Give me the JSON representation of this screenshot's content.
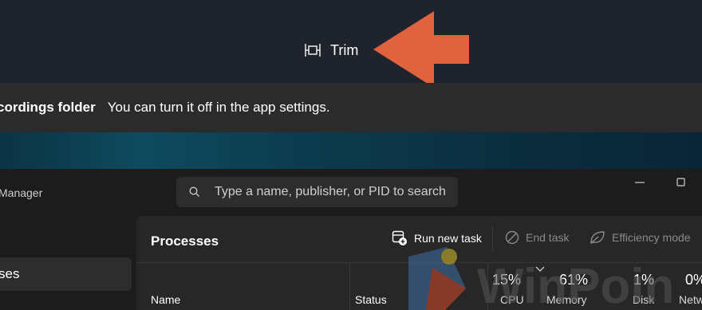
{
  "toolbar": {
    "trim_label": "Trim",
    "trim_icon": "trim-icon",
    "arrow_color": "#e0623f"
  },
  "notification": {
    "title": "cordings folder",
    "text": "You can turn it off in the app settings."
  },
  "task_manager": {
    "title": "Manager",
    "search": {
      "placeholder": "Type a name, publisher, or PID to search"
    },
    "sidebar": {
      "selected_item": "ses"
    },
    "processes": {
      "title": "Processes",
      "commands": {
        "run_new_task": "Run new task",
        "end_task": "End task",
        "efficiency_mode": "Efficiency mode"
      },
      "columns": {
        "name": "Name",
        "status": "Status",
        "cpu": {
          "label": "CPU",
          "percent": "15%"
        },
        "memory": {
          "label": "Memory",
          "percent": "61%"
        },
        "disk": {
          "label": "Disk",
          "percent": "1%"
        },
        "network": {
          "label": "Netw",
          "percent": "0%"
        }
      }
    }
  },
  "watermark": {
    "text": "WinPoin"
  },
  "colors": {
    "accent_arrow": "#e0623f",
    "toolbar_bg": "#1f242c",
    "panel_bg": "#272727"
  }
}
